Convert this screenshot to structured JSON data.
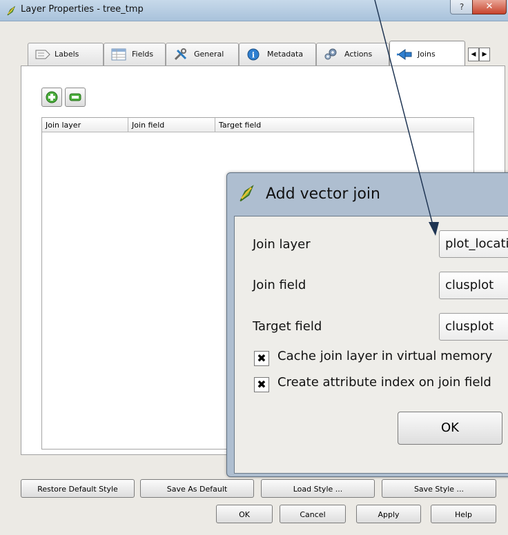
{
  "window": {
    "title": "Layer Properties - tree_tmp",
    "help_glyph": "?",
    "close_glyph": "✕"
  },
  "tabs": [
    {
      "label": "Labels",
      "icon": "labels-icon"
    },
    {
      "label": "Fields",
      "icon": "fields-icon"
    },
    {
      "label": "General",
      "icon": "general-icon"
    },
    {
      "label": "Metadata",
      "icon": "metadata-icon"
    },
    {
      "label": "Actions",
      "icon": "actions-icon"
    },
    {
      "label": "Joins",
      "icon": "joins-icon",
      "active": true
    }
  ],
  "tab_scroll": {
    "left": "◀",
    "right": "▶"
  },
  "joins_table": {
    "columns": [
      "Join layer",
      "Join field",
      "Target field"
    ],
    "rows": []
  },
  "bottom_buttons": {
    "restore_default": "Restore Default Style",
    "save_as_default": "Save As Default",
    "load_style": "Load Style ...",
    "save_style": "Save Style ...",
    "ok": "OK",
    "cancel": "Cancel",
    "apply": "Apply",
    "help": "Help"
  },
  "dialog": {
    "title": "Add vector join",
    "join_layer_label": "Join layer",
    "join_layer_value": "plot_locati",
    "join_field_label": "Join field",
    "join_field_value": "clusplot",
    "target_field_label": "Target field",
    "target_field_value": "clusplot",
    "cache_checkbox_label": "Cache join layer in virtual memory",
    "cache_checked": true,
    "index_checkbox_label": "Create attribute index on join field",
    "index_checked": true,
    "check_glyph": "✖",
    "ok": "OK"
  },
  "colors": {
    "arrow": "#1f3553",
    "title_bar": "#b7cde2",
    "dialog_frame": "#aebed0"
  }
}
